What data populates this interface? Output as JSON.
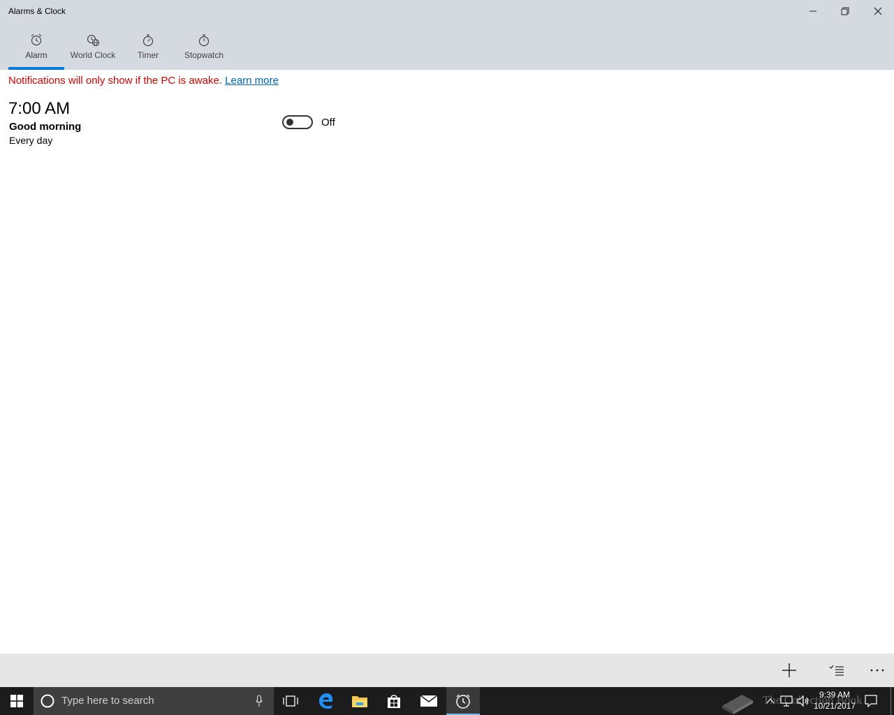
{
  "window": {
    "title": "Alarms & Clock",
    "controls": [
      "minimize-icon",
      "restore-icon",
      "close-icon"
    ]
  },
  "tabs": [
    {
      "label": "Alarm",
      "icon": "alarm-clock-icon",
      "selected": true
    },
    {
      "label": "World Clock",
      "icon": "world-clock-icon",
      "selected": false
    },
    {
      "label": "Timer",
      "icon": "timer-icon",
      "selected": false
    },
    {
      "label": "Stopwatch",
      "icon": "stopwatch-icon",
      "selected": false
    }
  ],
  "notice": {
    "text": "Notifications will only show if the PC is awake.",
    "link": "Learn more"
  },
  "alarms": [
    {
      "time": "7:00 AM",
      "name": "Good morning",
      "repeat": "Every day",
      "state": "Off",
      "enabled": false
    }
  ],
  "command_bar": {
    "buttons": [
      "add-icon",
      "select-alarms-icon",
      "more-options-icon"
    ]
  },
  "taskbar": {
    "search_placeholder": "Type here to search",
    "pinned": [
      "task-view-icon",
      "edge-icon",
      "file-explorer-icon",
      "store-icon",
      "mail-icon",
      "alarms-app-icon"
    ],
    "clock_time": "9:39 AM",
    "clock_date": "10/21/2017",
    "watermark": "The Collection Book"
  },
  "colors": {
    "accent": "#0078d7",
    "notice": "#c50500",
    "link": "#0063b1",
    "header": "#d5dae0",
    "taskbar": "#1c1c1c"
  }
}
